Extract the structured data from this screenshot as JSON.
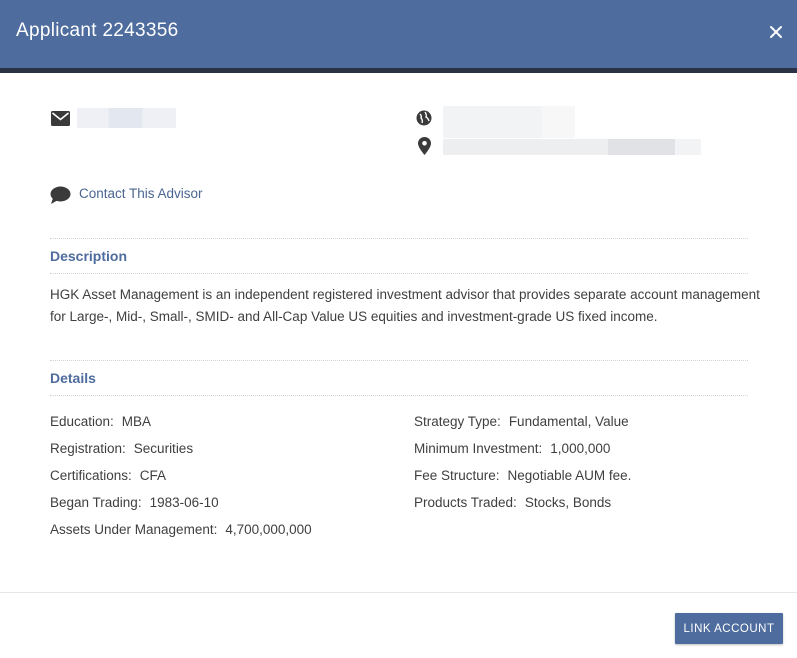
{
  "modal": {
    "title": "Applicant 2243356",
    "close_icon": "close-icon"
  },
  "contact": {
    "email_icon": "envelope-icon",
    "website_icon": "globe-icon",
    "location_icon": "map-pin-icon",
    "chat_icon": "chat-bubble-icon",
    "contact_label": "Contact This Advisor"
  },
  "description": {
    "heading": "Description",
    "text": "HGK Asset Management is an independent registered investment advisor that provides separate account management for Large-, Mid-, Small-, SMID- and All-Cap Value US equities and investment-grade US fixed income."
  },
  "details": {
    "heading": "Details",
    "left": [
      {
        "label": "Education:",
        "value": "MBA"
      },
      {
        "label": "Registration:",
        "value": "Securities"
      },
      {
        "label": "Certifications:",
        "value": "CFA"
      },
      {
        "label": "Began Trading:",
        "value": "1983-06-10"
      },
      {
        "label": "Assets Under Management:",
        "value": "4,700,000,000"
      }
    ],
    "right": [
      {
        "label": "Strategy Type:",
        "value": "Fundamental, Value"
      },
      {
        "label": "Minimum Investment:",
        "value": "1,000,000"
      },
      {
        "label": "Fee Structure:",
        "value": "Negotiable AUM fee."
      },
      {
        "label": "Products Traded:",
        "value": "Stocks, Bonds"
      }
    ]
  },
  "footer": {
    "link_account_label": "LINK ACCOUNT"
  },
  "colors": {
    "header": "#4e6c9d",
    "header_bar": "#2b3245",
    "accent_text": "#4a6590",
    "button": "#4e6c9d"
  }
}
